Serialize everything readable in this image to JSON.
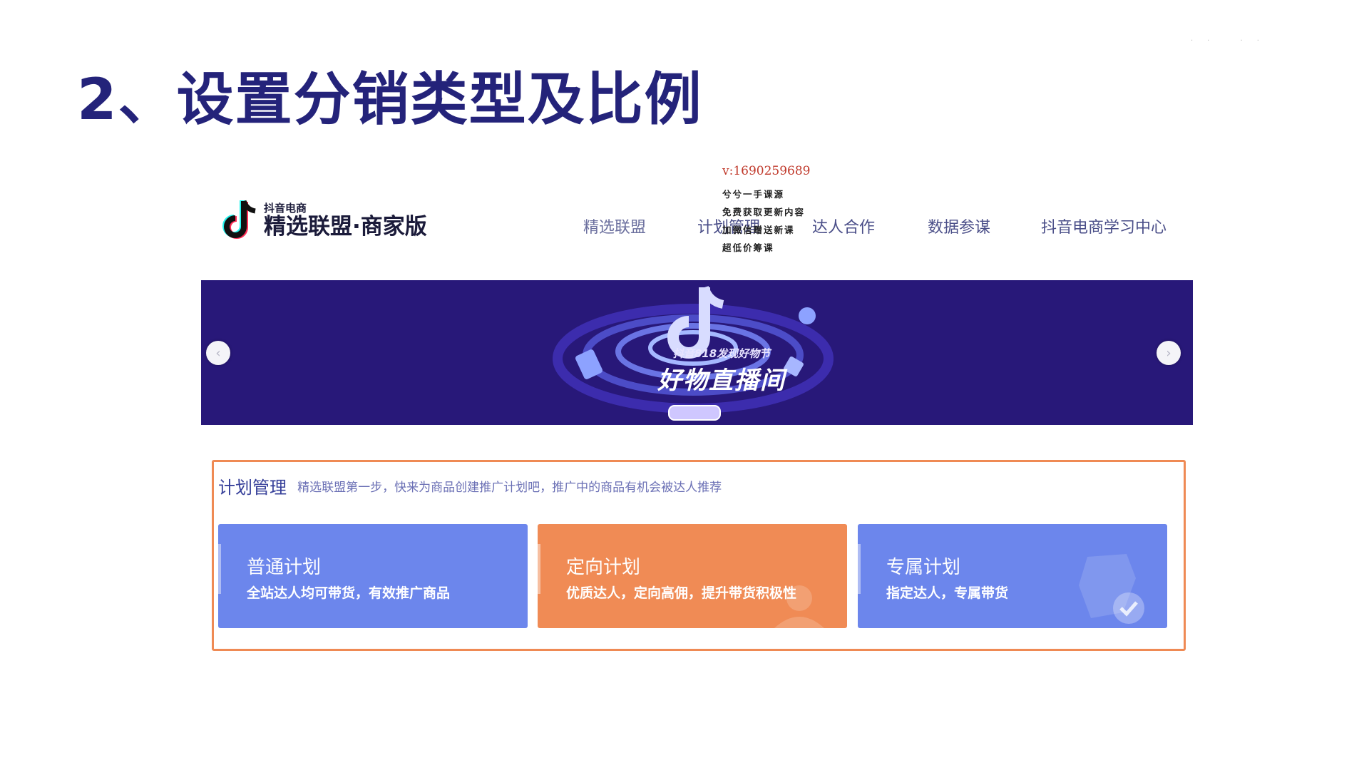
{
  "slide": {
    "title": "2、设置分销类型及比例"
  },
  "header": {
    "logo_small": "抖音电商",
    "logo_main": "精选联盟·商家版",
    "nav": [
      "精选联盟",
      "计划管理",
      "达人合作",
      "数据参谋",
      "抖音电商学习中心"
    ]
  },
  "watermark": {
    "phone": "v:1690259689",
    "lines": [
      "兮兮一手课源",
      "免费获取更新内容",
      "加微信赠送新课",
      "超低价筹课"
    ]
  },
  "banner": {
    "subtitle": "抖音818发现好物节",
    "title": "好物直播间",
    "prev": "‹",
    "next": "›"
  },
  "plan": {
    "title": "计划管理",
    "description": "精选联盟第一步，快来为商品创建推广计划吧，推广中的商品有机会被达人推荐",
    "cards": [
      {
        "title": "普通计划",
        "desc": "全站达人均可带货，有效推广商品"
      },
      {
        "title": "定向计划",
        "desc": "优质达人，定向高佣，提升带货积极性"
      },
      {
        "title": "专属计划",
        "desc": "指定达人，专属带货"
      }
    ]
  },
  "colors": {
    "title": "#24237a",
    "banner_bg": "#281879",
    "frame": "#ef8a54",
    "card_blue": "#6c86ec",
    "card_orange": "#f08b55"
  }
}
